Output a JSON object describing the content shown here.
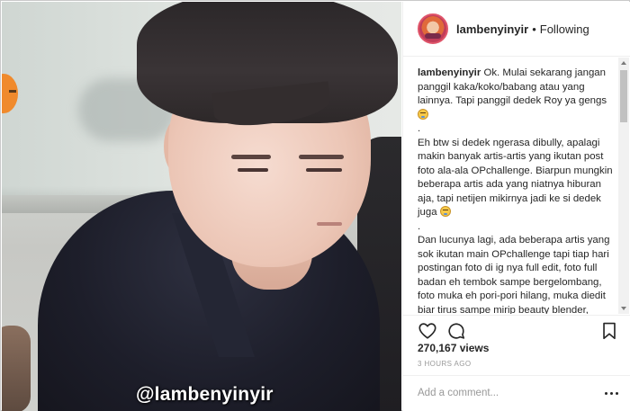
{
  "post": {
    "username": "lambenyinyir",
    "separator": "•",
    "follow_status": "Following",
    "watermark": "@lambenyinyir"
  },
  "caption": {
    "username": "lambenyinyir",
    "paragraph1": "Ok. Mulai sekarang jangan panggil kaka/koko/babang atau yang lainnya. Tapi panggil dedek Roy ya gengs",
    "emoji1": "sweat-smile-emoji",
    "divider1": ".",
    "paragraph2": "Eh btw si dedek ngerasa dibully, apalagi makin banyak artis-artis yang ikutan post foto ala-ala OPchallenge. Biarpun mungkin beberapa artis ada yang niatnya hiburan aja, tapi netijen mikirnya jadi ke si dedek juga",
    "emoji2": "sweat-smile-emoji",
    "divider2": ".",
    "paragraph3": "Dan lucunya lagi, ada beberapa artis yang sok ikutan main OPchallenge tapi tiap hari postingan foto di ig nya full edit, foto full badan eh tembok sampe bergelombang, foto muka eh pori-pori hilang, muka diedit biar tirus sampe mirip beauty blender, malah ada yang posting video eh background divideonya goyang semua. Lol."
  },
  "stats": {
    "views_count": "270,167",
    "views_label": "views",
    "time_ago": "3 HOURS AGO"
  },
  "comment": {
    "placeholder": "Add a comment..."
  },
  "icons": {
    "like": "heart-icon",
    "comment": "comment-icon",
    "save": "bookmark-icon",
    "more": "more-options-icon"
  },
  "colors": {
    "text": "#262626",
    "muted": "#999999",
    "divider": "#efefef",
    "avatar_ring": "#e0556a"
  }
}
